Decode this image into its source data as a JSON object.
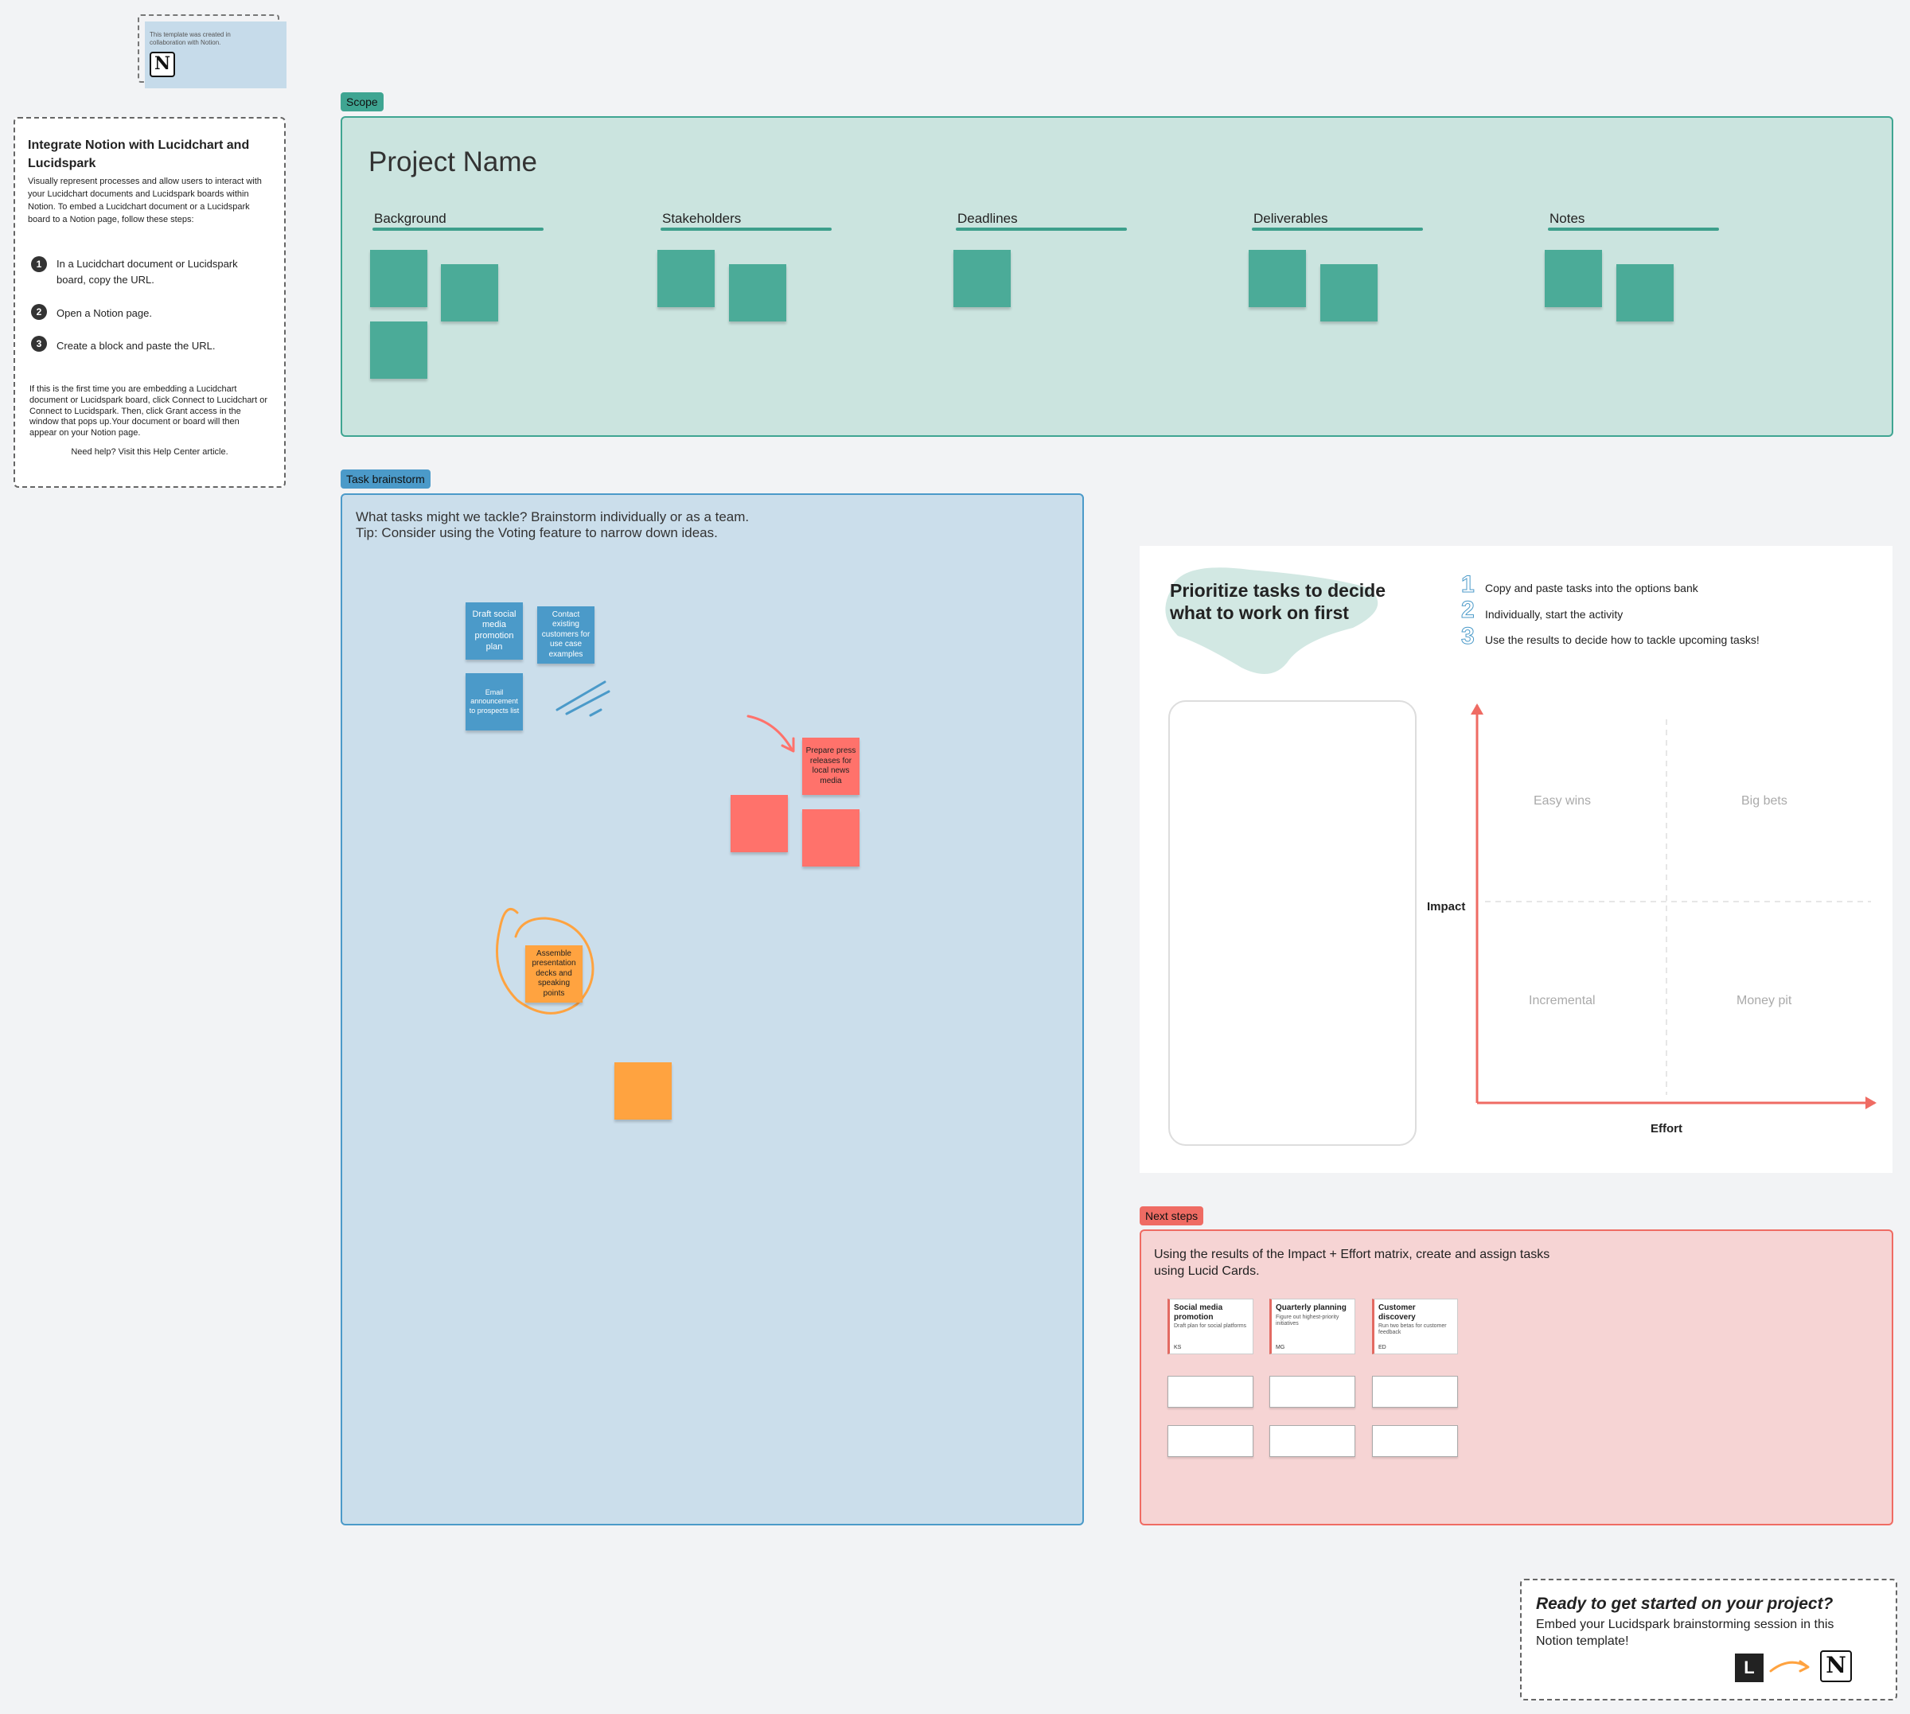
{
  "credit": {
    "text": "This template was created in collaboration with Notion."
  },
  "info_panel": {
    "title": "Integrate Notion with Lucidchart and Lucidspark",
    "description": "Visually represent processes and allow users to interact with your Lucidchart documents and Lucidspark boards within Notion. To embed a Lucidchart document or a Lucidspark board to a Notion page, follow these steps:",
    "steps": [
      {
        "num": "1",
        "text": "In a Lucidchart document or Lucidspark board, copy the URL."
      },
      {
        "num": "2",
        "text": "Open a Notion page."
      },
      {
        "num": "3",
        "text": "Create a block and paste the URL."
      }
    ],
    "first_time": "If this is the first time you are embedding a Lucidchart document or Lucidspark board, click Connect to Lucidchart or Connect to Lucidspark. Then, click Grant access in the window that pops up.Your document or board will then appear on your Notion page.",
    "help": "Need help? Visit this Help Center article."
  },
  "scope": {
    "tag": "Scope",
    "title": "Project Name",
    "columns": [
      "Background",
      "Stakeholders",
      "Deadlines",
      "Deliverables",
      "Notes"
    ]
  },
  "brainstorm": {
    "tag": "Task brainstorm",
    "prompt_line1": "What tasks might we tackle? Brainstorm individually or as a team.",
    "prompt_line2": "Tip: Consider using the Voting feature to narrow down ideas.",
    "stickies": {
      "social": "Draft social media promotion plan",
      "contact": "Contact existing customers for use case examples",
      "email": "Email announcement to prospects list",
      "press": "Prepare press releases for local news media",
      "assemble": "Assemble presentation decks and speaking points"
    }
  },
  "prioritize": {
    "title": "Prioritize tasks to decide what to work on first",
    "steps": [
      {
        "num": "1",
        "text": "Copy and paste tasks into the options bank"
      },
      {
        "num": "2",
        "text": "Individually, start the activity"
      },
      {
        "num": "3",
        "text": "Use the results to decide how to tackle upcoming tasks!"
      }
    ],
    "y_label": "Impact",
    "x_label": "Effort",
    "quadrants": {
      "top_left": "Easy wins",
      "top_right": "Big bets",
      "bottom_left": "Incremental",
      "bottom_right": "Money pit"
    }
  },
  "next_steps": {
    "tag": "Next steps",
    "prompt": "Using the results of the Impact + Effort matrix, create and assign tasks using Lucid Cards.",
    "cards": [
      {
        "title": "Social media promotion",
        "desc": "Draft plan for social platforms",
        "initials": "KS"
      },
      {
        "title": "Quarterly planning",
        "desc": "Figure out highest-priority initiatives",
        "initials": "MG"
      },
      {
        "title": "Customer discovery",
        "desc": "Run two betas for customer feedback",
        "initials": "ED"
      }
    ]
  },
  "cta": {
    "title": "Ready to get started on your project?",
    "body": "Embed your Lucidspark brainstorming session in this Notion template!"
  },
  "colors": {
    "scope": "#cbe4df",
    "brainstorm": "#cbdeeb",
    "next_steps": "#f6d4d4",
    "teal_sticky": "#4bab98",
    "accent_red": "#ef6b63"
  }
}
